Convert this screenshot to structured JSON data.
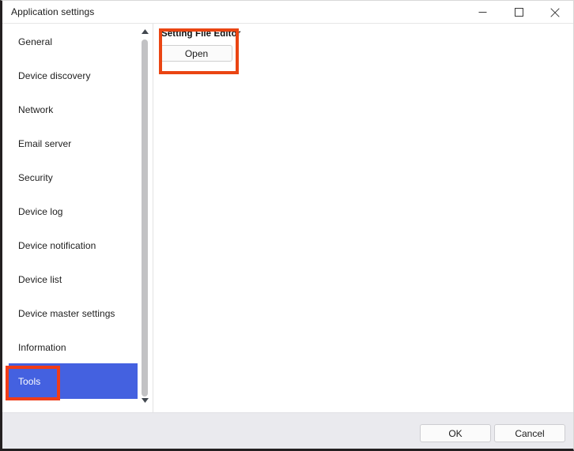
{
  "window": {
    "title": "Application settings",
    "controls": {
      "minimize": {
        "name": "minimize-button",
        "glyph": "minimize-icon"
      },
      "maximize": {
        "name": "maximize-button",
        "glyph": "maximize-icon"
      },
      "close": {
        "name": "close-button",
        "glyph": "close-icon"
      }
    }
  },
  "sidebar": {
    "items": [
      {
        "label": "General",
        "selected": false
      },
      {
        "label": "Device discovery",
        "selected": false
      },
      {
        "label": "Network",
        "selected": false
      },
      {
        "label": "Email server",
        "selected": false
      },
      {
        "label": "Security",
        "selected": false
      },
      {
        "label": "Device log",
        "selected": false
      },
      {
        "label": "Device notification",
        "selected": false
      },
      {
        "label": "Device list",
        "selected": false
      },
      {
        "label": "Device master settings",
        "selected": false
      },
      {
        "label": "Information",
        "selected": false
      },
      {
        "label": "Tools",
        "selected": true
      }
    ],
    "selected_label": "Tools",
    "selected_color": "#4461e0",
    "scrollbar": {
      "up_arrow": "scroll-up-arrow-icon",
      "down_arrow": "scroll-down-arrow-icon",
      "thumb_color": "#c2c2c4"
    }
  },
  "content": {
    "panel_title": "Setting File Editor",
    "open_button_label": "Open"
  },
  "annotations": {
    "editor_box_color": "#ea4513",
    "tools_box_color": "#f03c18"
  },
  "footer": {
    "ok_label": "OK",
    "cancel_label": "Cancel"
  }
}
